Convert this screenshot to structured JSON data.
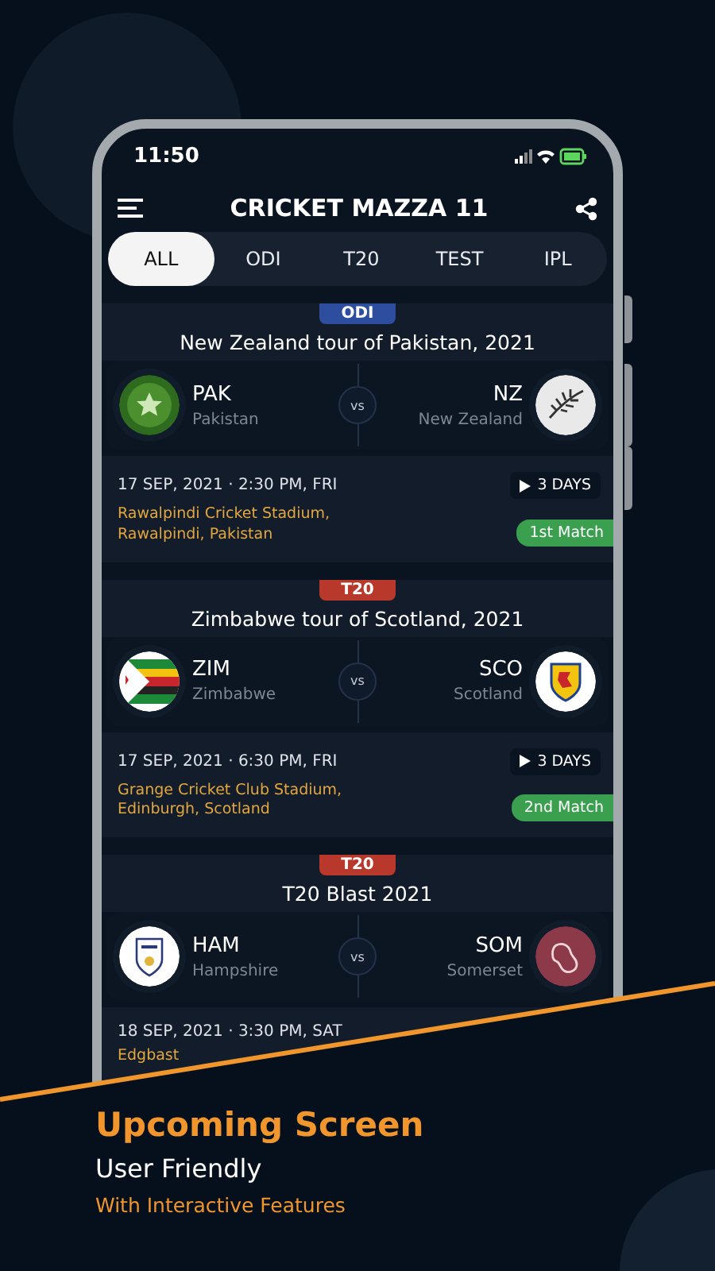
{
  "status_bar": {
    "time": "11:50"
  },
  "app_bar": {
    "title": "CRICKET MAZZA 11"
  },
  "tabs": [
    {
      "label": "ALL",
      "selected": true
    },
    {
      "label": "ODI",
      "selected": false
    },
    {
      "label": "T20",
      "selected": false
    },
    {
      "label": "TEST",
      "selected": false
    },
    {
      "label": "IPL",
      "selected": false
    }
  ],
  "matches": [
    {
      "format": "ODI",
      "color": "#2d4e9e",
      "series": "New Zealand tour of Pakistan, 2021",
      "home": {
        "code": "PAK",
        "name": "Pakistan"
      },
      "vs": "vs",
      "away": {
        "code": "NZ",
        "name": "New Zealand"
      },
      "date": "17 SEP, 2021 · 2:30 PM, FRI",
      "countdown": "3 DAYS",
      "venue": "Rawalpindi Cricket Stadium,\nRawalpindi, Pakistan",
      "match_no": "1st Match"
    },
    {
      "format": "T20",
      "color": "#b8392b",
      "series": "Zimbabwe tour of Scotland, 2021",
      "home": {
        "code": "ZIM",
        "name": "Zimbabwe"
      },
      "vs": "vs",
      "away": {
        "code": "SCO",
        "name": "Scotland"
      },
      "date": "17 SEP, 2021 · 6:30 PM, FRI",
      "countdown": "3 DAYS",
      "venue": "Grange Cricket Club Stadium,\nEdinburgh, Scotland",
      "match_no": "2nd Match"
    },
    {
      "format": "T20",
      "color": "#b8392b",
      "series": "T20 Blast 2021",
      "home": {
        "code": "HAM",
        "name": "Hampshire"
      },
      "vs": "vs",
      "away": {
        "code": "SOM",
        "name": "Somerset"
      },
      "date": "18 SEP, 2021 · 3:30 PM, SAT",
      "venue": "Edgbast"
    }
  ],
  "promo": {
    "headline": "Upcoming Screen",
    "subtitle": "User Friendly",
    "tagline": "With Interactive Features"
  }
}
